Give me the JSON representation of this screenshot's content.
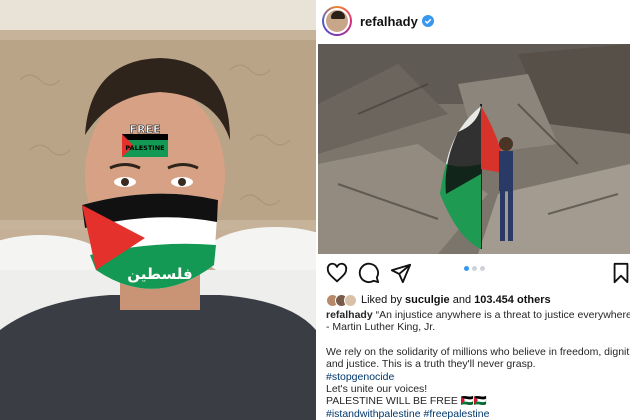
{
  "post": {
    "username": "refalhady",
    "likes": {
      "prefix": "Liked by",
      "first_user": "suculgie",
      "and": "and",
      "count": "103.454 others"
    },
    "caption": {
      "user": "refalhady",
      "quote_line1": "“An injustice anywhere is a threat to justice everywhere",
      "quote_line2": "- Martin Luther King, Jr.",
      "para_line1": "We rely on the solidarity of millions who believe in freedom, dignit",
      "para_line2": "and justice. This is a truth they'll never grasp.",
      "hashtag1": "#stopgenocide",
      "line_unite": "Let's unite our voices!",
      "line_free": "PALESTINE WILL BE FREE 🇵🇸🇵🇸",
      "hashtags2": "#istandwithpalestine #freepalestine"
    },
    "carousel_page": 1,
    "carousel_total": 3
  },
  "selfie": {
    "forehead_text_top": "FREE",
    "forehead_text_bottom": "PALESTINE",
    "mask_text": "فلسطين"
  },
  "colors": {
    "verified_blue": "#3897f0",
    "palestine_black": "#000000",
    "palestine_white": "#ffffff",
    "palestine_green": "#149954",
    "palestine_red": "#e4312b"
  },
  "icons": [
    "heart-icon",
    "comment-icon",
    "share-icon",
    "bookmark-icon",
    "verified-icon"
  ]
}
